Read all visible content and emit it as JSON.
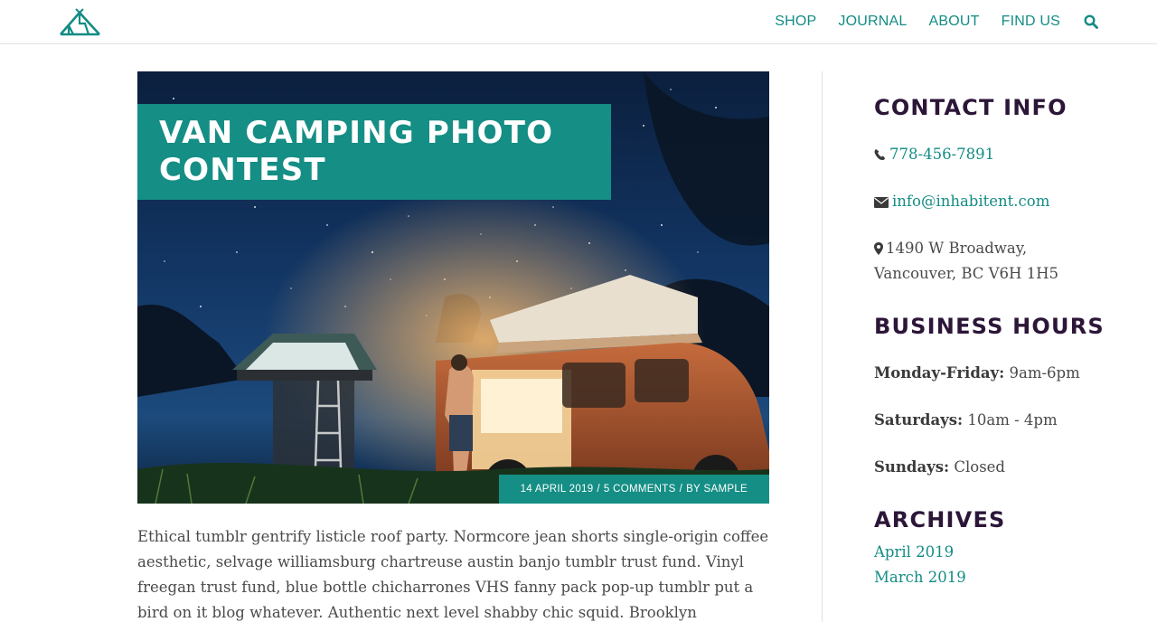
{
  "header": {
    "nav": [
      "SHOP",
      "JOURNAL",
      "ABOUT",
      "FIND US"
    ]
  },
  "post": {
    "title": "VAN CAMPING PHOTO CONTEST",
    "date": "14 APRIL 2019",
    "comments": "5 COMMENTS",
    "by": "BY",
    "author": "SAMPLE",
    "excerpt": "Ethical tumblr gentrify listicle roof party. Normcore jean shorts single-origin coffee aesthetic, selvage williamsburg chartreuse austin banjo tumblr trust fund. Vinyl freegan trust fund, blue bottle chicharrones VHS fanny pack pop-up tumblr put a bird on it blog whatever. Authentic next level shabby chic squid. Brooklyn chicharrones fanny pack"
  },
  "sidebar": {
    "contact_title": "CONTACT INFO",
    "phone": "778-456-7891",
    "email": "info@inhabitent.com",
    "address_line1": "1490 W Broadway,",
    "address_line2": "Vancouver, BC V6H 1H5",
    "hours_title": "BUSINESS HOURS",
    "hours": [
      {
        "day": "Monday-Friday:",
        "time": "9am-6pm"
      },
      {
        "day": "Saturdays:",
        "time": "10am - 4pm"
      },
      {
        "day": "Sundays:",
        "time": "Closed"
      }
    ],
    "archives_title": "ARCHIVES",
    "archives": [
      "April 2019",
      "March 2019"
    ]
  },
  "colors": {
    "accent": "#158e85",
    "heading": "#2c1638",
    "text": "#4a4a4a"
  },
  "icons": [
    "tent-logo",
    "search-icon",
    "phone-icon",
    "envelope-icon",
    "map-marker-icon"
  ]
}
